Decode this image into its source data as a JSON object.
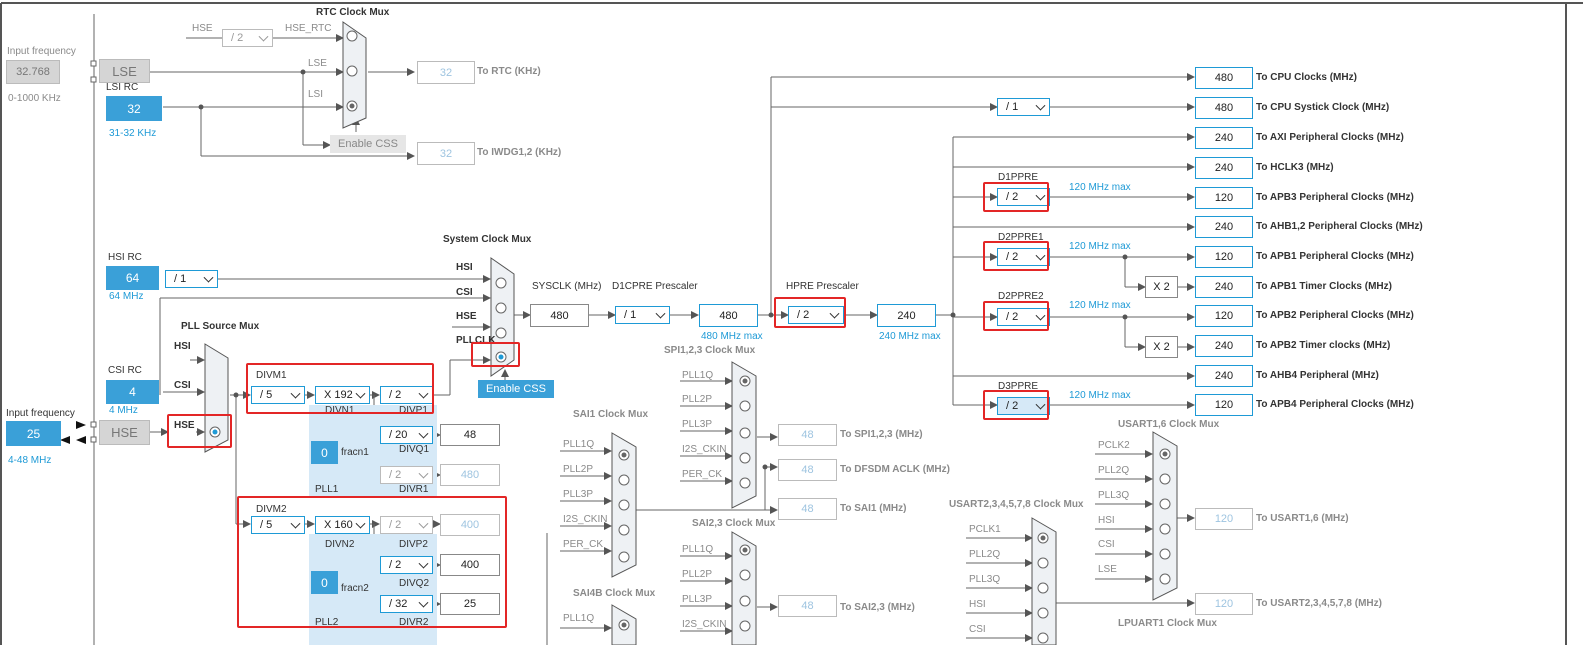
{
  "colors": {
    "accent": "#1e9ad6",
    "source_fill": "#3aa0d8",
    "highlight": "#e32626",
    "region": "#d6e9f7"
  },
  "lse": {
    "input_label": "Input frequency",
    "input_value": "32.768",
    "range": "0-1000 KHz",
    "name": "LSE"
  },
  "lsi": {
    "label": "LSI RC",
    "value": "32",
    "range": "31-32 KHz"
  },
  "rtc": {
    "mux_label": "RTC Clock Mux",
    "div_select": "/ 2",
    "hse": "HSE",
    "hse_rtc": "HSE_RTC",
    "lse": "LSE",
    "lsi": "LSI",
    "enable_css": "Enable CSS",
    "out_value": "32",
    "out_label": "To RTC (KHz)",
    "iwdg_value": "32",
    "iwdg_label": "To IWDG1,2 (KHz)"
  },
  "hsi": {
    "label": "HSI RC",
    "value": "64",
    "range": "64 MHz",
    "div": "/ 1"
  },
  "csi": {
    "label": "CSI RC",
    "value": "4",
    "range": "4 MHz"
  },
  "hse": {
    "input_label": "Input frequency",
    "value": "25",
    "range": "4-48 MHz",
    "name": "HSE"
  },
  "pll_src": {
    "label": "PLL Source Mux",
    "hsi": "HSI",
    "csi": "CSI",
    "hse": "HSE"
  },
  "sysmux": {
    "label": "System Clock Mux",
    "hsi": "HSI",
    "csi": "CSI",
    "hse": "HSE",
    "pllclk": "PLLCLK",
    "enable_css": "Enable CSS"
  },
  "sysclk": {
    "label": "SYSCLK (MHz)",
    "value": "480"
  },
  "d1cpre": {
    "label": "D1CPRE Prescaler",
    "div": "/ 1",
    "value": "480",
    "max": "480 MHz max"
  },
  "hpre": {
    "label": "HPRE Prescaler",
    "div": "/ 2",
    "value": "240",
    "max": "240 MHz max"
  },
  "pll1": {
    "divm_label": "DIVM1",
    "divm": "/ 5",
    "divn": "X 192",
    "divn_label": "DIVN1",
    "divp": "/ 2",
    "divp_label": "DIVP1",
    "divq": "/ 20",
    "divq_label": "DIVQ1",
    "divq_out": "48",
    "divr": "/ 2",
    "divr_label": "DIVR1",
    "divr_out": "480",
    "fracn": "0",
    "fracn_label": "fracn1",
    "name": "PLL1"
  },
  "pll2": {
    "divm_label": "DIVM2",
    "divm": "/ 5",
    "divn": "X 160",
    "divn_label": "DIVN2",
    "divp": "/ 2",
    "divp_label": "DIVP2",
    "divp_out": "400",
    "divq": "/ 2",
    "divq_label": "DIVQ2",
    "divq_out": "400",
    "divr": "/ 32",
    "divr_label": "DIVR2",
    "divr_out": "25",
    "fracn": "0",
    "fracn_label": "fracn2",
    "name": "PLL2"
  },
  "spi_mux": {
    "label": "SPI1,2,3 Clock Mux",
    "inputs": [
      "PLL1Q",
      "PLL2P",
      "PLL3P",
      "I2S_CKIN",
      "PER_CK"
    ],
    "out1": "48",
    "out1_label": "To SPI1,2,3 (MHz)",
    "out2": "48",
    "out2_label": "To DFSDM ACLK (MHz)",
    "out3": "48",
    "out3_label": "To SAI1 (MHz)"
  },
  "sai1_mux": {
    "label": "SAI1 Clock Mux",
    "inputs": [
      "PLL1Q",
      "PLL2P",
      "PLL3P",
      "I2S_CKIN",
      "PER_CK"
    ]
  },
  "sai23_mux": {
    "label": "SAI2,3 Clock Mux",
    "inputs": [
      "PLL1Q",
      "PLL2P",
      "PLL3P",
      "I2S_CKIN"
    ],
    "out": "48",
    "out_label": "To SAI2,3 (MHz)"
  },
  "sai4b_mux": {
    "label": "SAI4B Clock Mux",
    "inputs": [
      "PLL1Q"
    ]
  },
  "usart16": {
    "label": "USART1,6 Clock Mux",
    "inputs": [
      "PCLK2",
      "PLL2Q",
      "PLL3Q",
      "HSI",
      "CSI",
      "LSE"
    ],
    "out": "120",
    "out_label": "To USART1,6 (MHz)"
  },
  "usart2345": {
    "label": "USART2,3,4,5,7,8 Clock Mux",
    "inputs": [
      "PCLK1",
      "PLL2Q",
      "PLL3Q",
      "HSI",
      "CSI"
    ],
    "out": "120",
    "out_label": "To USART2,3,4,5,7,8 (MHz)"
  },
  "lpuart1": {
    "label": "LPUART1 Clock Mux"
  },
  "cpu_div": "/ 1",
  "outputs": [
    {
      "value": "480",
      "label": "To CPU Clocks (MHz)"
    },
    {
      "value": "480",
      "label": "To CPU Systick Clock (MHz)"
    },
    {
      "value": "240",
      "label": "To AXI Peripheral Clocks (MHz)"
    },
    {
      "value": "240",
      "label": "To HCLK3 (MHz)"
    },
    {
      "value": "120",
      "label": "To APB3 Peripheral Clocks (MHz)"
    },
    {
      "value": "240",
      "label": "To AHB1,2 Peripheral Clocks (MHz)"
    },
    {
      "value": "120",
      "label": "To APB1 Peripheral Clocks (MHz)"
    },
    {
      "value": "240",
      "label": "To APB1 Timer Clocks (MHz)"
    },
    {
      "value": "120",
      "label": "To APB2 Peripheral Clocks (MHz)"
    },
    {
      "value": "240",
      "label": "To APB2 Timer clocks (MHz)"
    },
    {
      "value": "240",
      "label": "To AHB4 Peripheral (MHz)"
    },
    {
      "value": "120",
      "label": "To APB4 Peripheral Clocks (MHz)"
    }
  ],
  "d1ppre": {
    "label": "D1PPRE",
    "div": "/ 2",
    "max": "120 MHz max"
  },
  "d2ppre1": {
    "label": "D2PPRE1",
    "div": "/ 2",
    "max": "120 MHz max",
    "x2": "X 2"
  },
  "d2ppre2": {
    "label": "D2PPRE2",
    "div": "/ 2",
    "max": "120 MHz max",
    "x2": "X 2"
  },
  "d3ppre": {
    "label": "D3PPRE",
    "div": "/ 2",
    "max": "120 MHz max"
  }
}
